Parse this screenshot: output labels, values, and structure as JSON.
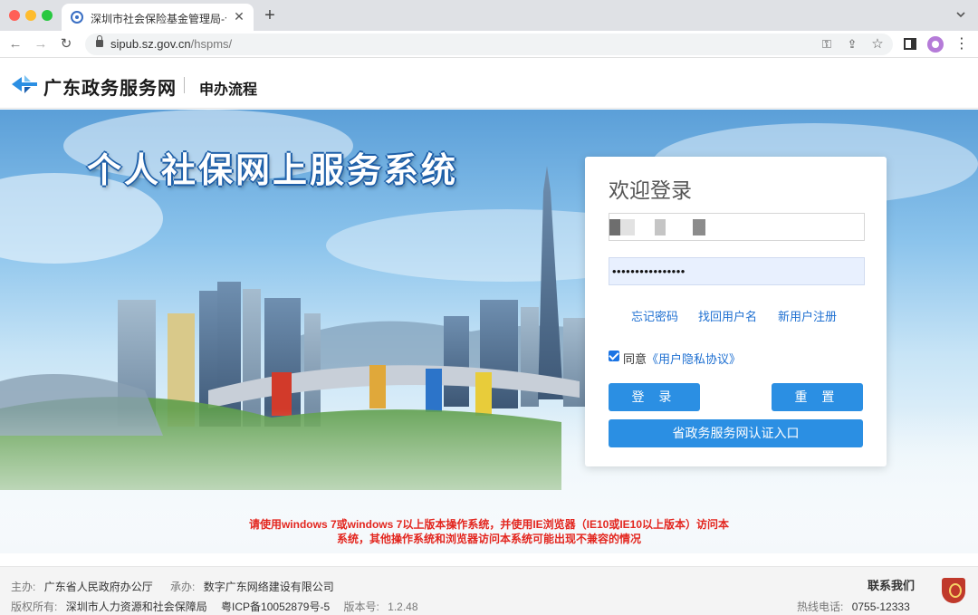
{
  "browser": {
    "tab_title": "深圳市社会保险基金管理局-个人",
    "new_tab": "+",
    "url_host": "sipub.sz.gov.cn",
    "url_path": "/hspms/"
  },
  "header": {
    "site_name": "广东政务服务网",
    "nav_link": "申办流程"
  },
  "banner": {
    "title": "个人社保网上服务系统"
  },
  "login": {
    "title": "欢迎登录",
    "password_dots": "••••••••••••••••",
    "forgot_password": "忘记密码",
    "find_username": "找回用户名",
    "register": "新用户注册",
    "agree_label": "同意",
    "agree_link": "《用户隐私协议》",
    "agree_checked": true,
    "login_button": "登 录",
    "reset_button": "重 置",
    "province_button": "省政务服务网认证入口"
  },
  "notice": {
    "line1": "请使用windows 7或windows 7以上版本操作系统，并使用IE浏览器（IE10或IE10以上版本）访问本",
    "line2": "系统，其他操作系统和浏览器访问本系统可能出现不兼容的情况"
  },
  "footer": {
    "host_label": "主办:",
    "host_value": "广东省人民政府办公厅",
    "builder_label": "承办:",
    "builder_value": "数字广东网络建设有限公司",
    "copyright_label": "版权所有:",
    "copyright_value": "深圳市人力资源和社会保障局",
    "icp": "粤ICP备10052879号-5",
    "version_label": "版本号:",
    "version_value": "1.2.48",
    "contact_title": "联系我们",
    "hotline_label": "热线电话:",
    "hotline_value": "0755-12333"
  },
  "colors": {
    "accent": "#2b8fe3",
    "link": "#1d6fd1",
    "notice": "#e3261f"
  }
}
